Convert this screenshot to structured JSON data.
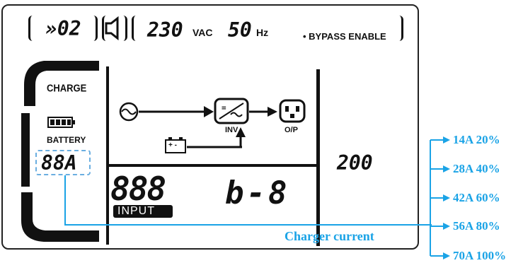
{
  "top_bar": {
    "mode_code": "»02",
    "voltage": "230",
    "voltage_unit": "VAC",
    "frequency": "50",
    "frequency_unit": "Hz",
    "bypass": "• BYPASS ENABLE"
  },
  "left_panel": {
    "charge_label": "CHARGE",
    "battery_label": "BATTERY",
    "current_readout": "88A"
  },
  "flow": {
    "inv_label": "INV",
    "op_label": "O/P",
    "battery_terminals": "+ -"
  },
  "bottom": {
    "input_digits": "888",
    "input_label": "INPUT",
    "code_display": "b-8"
  },
  "right_panel": {
    "value": "200"
  },
  "annotations": {
    "charger_current_label": "Charger current",
    "options": [
      "14A 20%",
      "28A 40%",
      "42A 60%",
      "56A 80%",
      "70A 100%"
    ]
  },
  "colors": {
    "annotation": "#1aa3e6",
    "lcd_ink": "#111111"
  }
}
